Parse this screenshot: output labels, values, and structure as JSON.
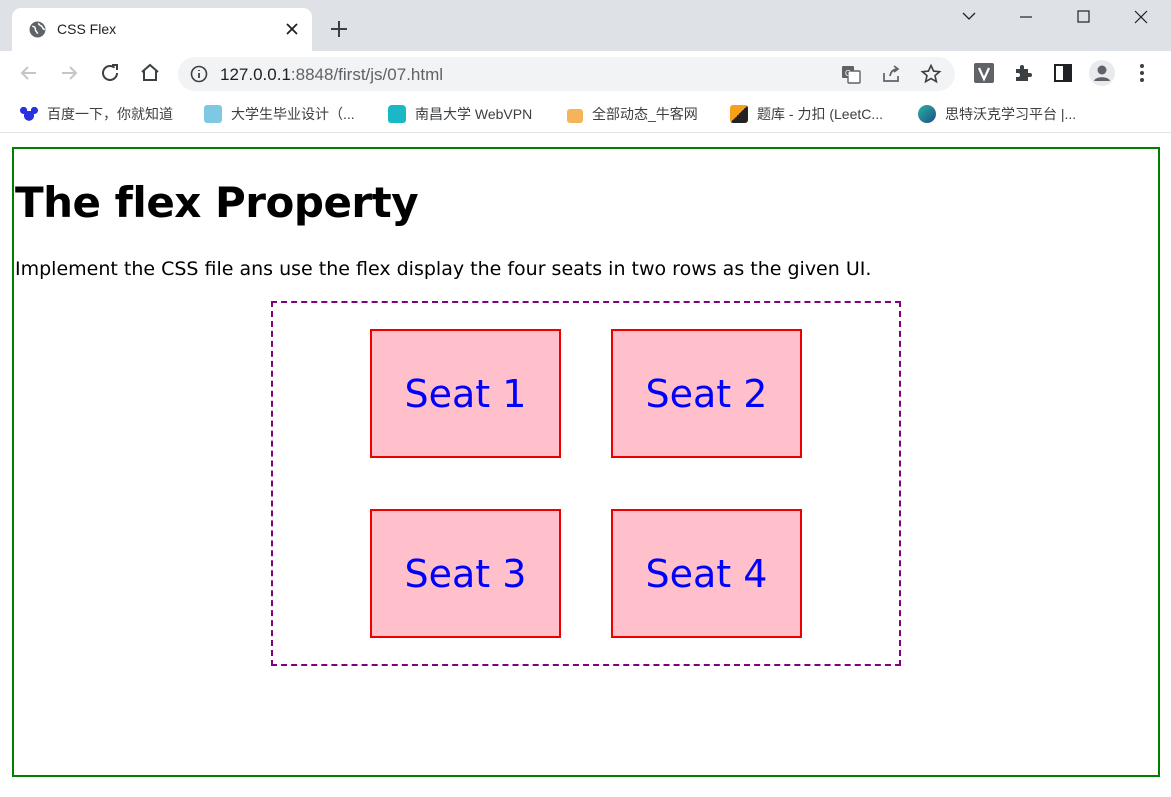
{
  "browser": {
    "tab_title": "CSS Flex",
    "url_host": "127.0.0.1",
    "url_path": ":8848/first/js/07.html"
  },
  "bookmarks": [
    {
      "label": "百度一下，你就知道",
      "icon": "baidu-icon"
    },
    {
      "label": "大学生毕业设计（...",
      "icon": "graduation-icon"
    },
    {
      "label": "南昌大学 WebVPN",
      "icon": "lock-icon"
    },
    {
      "label": "全部动态_牛客网",
      "icon": "nowcoder-icon"
    },
    {
      "label": "题库 - 力扣 (LeetC...",
      "icon": "leetcode-icon"
    },
    {
      "label": "思特沃克学习平台 |...",
      "icon": "thoughtworks-icon"
    }
  ],
  "page": {
    "heading": "The flex Property",
    "description": "Implement the CSS file ans use the flex display the four seats in two rows as the given UI.",
    "seats": [
      "Seat 1",
      "Seat 2",
      "Seat 3",
      "Seat 4"
    ]
  },
  "colors": {
    "frame_border": "#008000",
    "container_border": "#800080",
    "seat_bg": "#ffc0cb",
    "seat_border": "#ee0000",
    "seat_text": "#0000ff"
  }
}
